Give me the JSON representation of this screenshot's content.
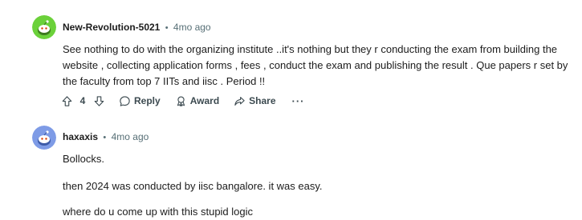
{
  "comments": [
    {
      "username": "New-Revolution-5021",
      "separator": "•",
      "time": "4mo ago",
      "avatar_color": "#6bd13a",
      "body": [
        "See nothing to do with the organizing institute ..it's nothing but they r conducting the exam from building the website , collecting application forms , fees , conduct the exam and publishing the result . Que papers r set by the faculty from top 7 IITs and iisc . Period !!"
      ],
      "actions": {
        "score": "4",
        "reply": "Reply",
        "award": "Award",
        "share": "Share",
        "more": "···"
      }
    },
    {
      "username": "haxaxis",
      "separator": "•",
      "time": "4mo ago",
      "avatar_color": "#7e9be6",
      "body": [
        "Bollocks.",
        "then 2024 was conducted by iisc bangalore. it was easy.",
        "where do u come up with this stupid logic"
      ]
    }
  ],
  "icons": {
    "upvote": "upvote-arrow-icon",
    "downvote": "downvote-arrow-icon",
    "reply": "speech-bubble-icon",
    "award": "award-ribbon-icon",
    "share": "share-arrow-icon"
  },
  "colors": {
    "text": "#1c1c1c",
    "meta": "#576f76",
    "action": "#3c4a50"
  }
}
